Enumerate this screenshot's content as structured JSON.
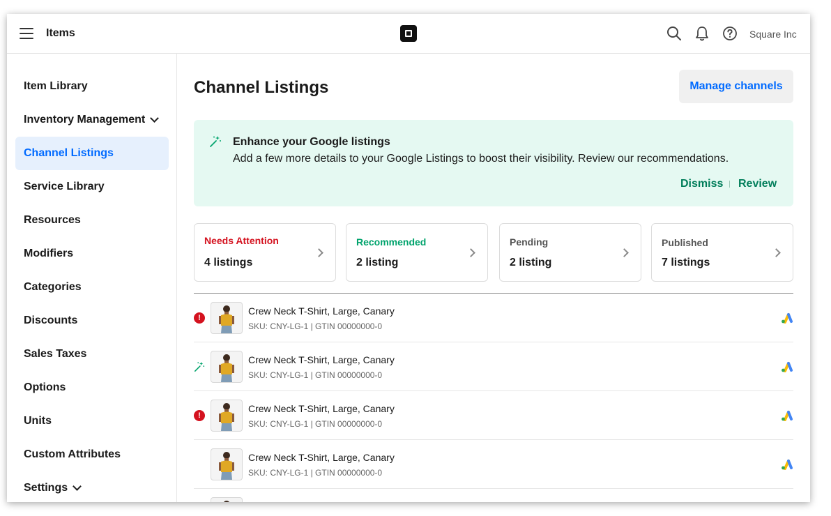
{
  "topbar": {
    "title": "Items",
    "account": "Square Inc"
  },
  "sidebar": {
    "items": [
      {
        "label": "Item Library"
      },
      {
        "label": "Inventory Management"
      },
      {
        "label": "Channel Listings"
      },
      {
        "label": "Service Library"
      },
      {
        "label": "Resources"
      },
      {
        "label": "Modifiers"
      },
      {
        "label": "Categories"
      },
      {
        "label": "Discounts"
      },
      {
        "label": "Sales Taxes"
      },
      {
        "label": "Options"
      },
      {
        "label": "Units"
      },
      {
        "label": "Custom Attributes"
      },
      {
        "label": "Settings"
      }
    ]
  },
  "main": {
    "title": "Channel Listings",
    "manage_button": "Manage channels",
    "banner": {
      "title": "Enhance your Google listings",
      "text": "Add a few more details to your Google Listings to boost their visibility. Review our recommendations.",
      "dismiss": "Dismiss",
      "review": "Review"
    },
    "cards": [
      {
        "label": "Needs Attention",
        "count": "4 listings",
        "color": "#d4121f"
      },
      {
        "label": "Recommended",
        "count": "2 listing",
        "color": "#00a36c"
      },
      {
        "label": "Pending",
        "count": "2 listing",
        "color": "#555555"
      },
      {
        "label": "Published",
        "count": "7 listings",
        "color": "#555555"
      }
    ],
    "rows": [
      {
        "status": "alert",
        "title": "Crew Neck T-Shirt, Large, Canary",
        "sku": "SKU: CNY-LG-1 | GTIN 00000000-0"
      },
      {
        "status": "recommended",
        "title": "Crew Neck T-Shirt, Large, Canary",
        "sku": "SKU: CNY-LG-1 | GTIN 00000000-0"
      },
      {
        "status": "alert",
        "title": "Crew Neck T-Shirt, Large, Canary",
        "sku": "SKU: CNY-LG-1 | GTIN 00000000-0"
      },
      {
        "status": "none",
        "title": "Crew Neck T-Shirt, Large, Canary",
        "sku": "SKU: CNY-LG-1 | GTIN 00000000-0"
      }
    ]
  },
  "colors": {
    "accent": "#006aff",
    "banner_bg": "#e5f9f2",
    "banner_link": "#007d5a",
    "alert": "#d4121f"
  },
  "icons": {
    "menu": "hamburger-icon",
    "logo": "square-logo",
    "search": "search-icon",
    "notifications": "bell-icon",
    "help": "help-icon",
    "banner": "sparkle-icon",
    "channel": "google-ads-icon"
  }
}
